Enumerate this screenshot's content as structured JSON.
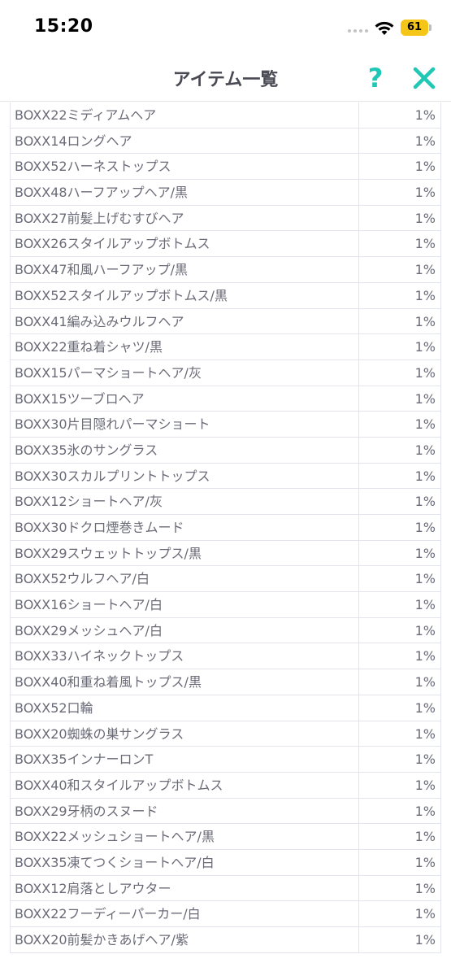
{
  "status": {
    "time": "15:20",
    "battery": "61"
  },
  "header": {
    "title": "アイテム一覧",
    "help_label": "?"
  },
  "items": [
    {
      "name": "BOXX22ミディアムヘア",
      "rate": "1%"
    },
    {
      "name": "BOXX14ロングヘア",
      "rate": "1%"
    },
    {
      "name": "BOXX52ハーネストップス",
      "rate": "1%"
    },
    {
      "name": "BOXX48ハーフアップヘア/黒",
      "rate": "1%"
    },
    {
      "name": "BOXX27前髪上げむすびヘア",
      "rate": "1%"
    },
    {
      "name": "BOXX26スタイルアップボトムス",
      "rate": "1%"
    },
    {
      "name": "BOXX47和風ハーフアップ/黒",
      "rate": "1%"
    },
    {
      "name": "BOXX52スタイルアップボトムス/黒",
      "rate": "1%"
    },
    {
      "name": "BOXX41編み込みウルフヘア",
      "rate": "1%"
    },
    {
      "name": "BOXX22重ね着シャツ/黒",
      "rate": "1%"
    },
    {
      "name": "BOXX15パーマショートヘア/灰",
      "rate": "1%"
    },
    {
      "name": "BOXX15ツーブロヘア",
      "rate": "1%"
    },
    {
      "name": "BOXX30片目隠れパーマショート",
      "rate": "1%"
    },
    {
      "name": "BOXX35氷のサングラス",
      "rate": "1%"
    },
    {
      "name": "BOXX30スカルプリントトップス",
      "rate": "1%"
    },
    {
      "name": "BOXX12ショートヘア/灰",
      "rate": "1%"
    },
    {
      "name": "BOXX30ドクロ煙巻きムード",
      "rate": "1%"
    },
    {
      "name": "BOXX29スウェットトップス/黒",
      "rate": "1%"
    },
    {
      "name": "BOXX52ウルフヘア/白",
      "rate": "1%"
    },
    {
      "name": "BOXX16ショートヘア/白",
      "rate": "1%"
    },
    {
      "name": "BOXX29メッシュヘア/白",
      "rate": "1%"
    },
    {
      "name": "BOXX33ハイネックトップス",
      "rate": "1%"
    },
    {
      "name": "BOXX40和重ね着風トップス/黒",
      "rate": "1%"
    },
    {
      "name": "BOXX52口輪",
      "rate": "1%"
    },
    {
      "name": "BOXX20蜘蛛の巣サングラス",
      "rate": "1%"
    },
    {
      "name": "BOXX35インナーロンT",
      "rate": "1%"
    },
    {
      "name": "BOXX40和スタイルアップボトムス",
      "rate": "1%"
    },
    {
      "name": "BOXX29牙柄のスヌード",
      "rate": "1%"
    },
    {
      "name": "BOXX22メッシュショートヘア/黒",
      "rate": "1%"
    },
    {
      "name": "BOXX35凍てつくショートヘア/白",
      "rate": "1%"
    },
    {
      "name": "BOXX12肩落としアウター",
      "rate": "1%"
    },
    {
      "name": "BOXX22フーディーパーカー/白",
      "rate": "1%"
    },
    {
      "name": "BOXX20前髪かきあげヘア/紫",
      "rate": "1%"
    }
  ],
  "colors": {
    "accent": "#1ec8b4",
    "text": "#6b6b78",
    "title": "#4a4a55",
    "border": "#e3e5ec",
    "battery": "#f5c518"
  }
}
